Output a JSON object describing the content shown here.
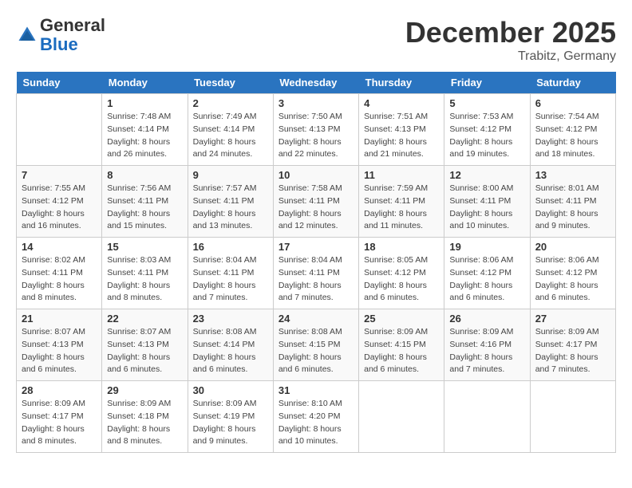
{
  "header": {
    "logo_line1": "General",
    "logo_line2": "Blue",
    "month_title": "December 2025",
    "location": "Trabitz, Germany"
  },
  "weekdays": [
    "Sunday",
    "Monday",
    "Tuesday",
    "Wednesday",
    "Thursday",
    "Friday",
    "Saturday"
  ],
  "weeks": [
    [
      {
        "day": "",
        "info": ""
      },
      {
        "day": "1",
        "info": "Sunrise: 7:48 AM\nSunset: 4:14 PM\nDaylight: 8 hours\nand 26 minutes."
      },
      {
        "day": "2",
        "info": "Sunrise: 7:49 AM\nSunset: 4:14 PM\nDaylight: 8 hours\nand 24 minutes."
      },
      {
        "day": "3",
        "info": "Sunrise: 7:50 AM\nSunset: 4:13 PM\nDaylight: 8 hours\nand 22 minutes."
      },
      {
        "day": "4",
        "info": "Sunrise: 7:51 AM\nSunset: 4:13 PM\nDaylight: 8 hours\nand 21 minutes."
      },
      {
        "day": "5",
        "info": "Sunrise: 7:53 AM\nSunset: 4:12 PM\nDaylight: 8 hours\nand 19 minutes."
      },
      {
        "day": "6",
        "info": "Sunrise: 7:54 AM\nSunset: 4:12 PM\nDaylight: 8 hours\nand 18 minutes."
      }
    ],
    [
      {
        "day": "7",
        "info": "Sunrise: 7:55 AM\nSunset: 4:12 PM\nDaylight: 8 hours\nand 16 minutes."
      },
      {
        "day": "8",
        "info": "Sunrise: 7:56 AM\nSunset: 4:11 PM\nDaylight: 8 hours\nand 15 minutes."
      },
      {
        "day": "9",
        "info": "Sunrise: 7:57 AM\nSunset: 4:11 PM\nDaylight: 8 hours\nand 13 minutes."
      },
      {
        "day": "10",
        "info": "Sunrise: 7:58 AM\nSunset: 4:11 PM\nDaylight: 8 hours\nand 12 minutes."
      },
      {
        "day": "11",
        "info": "Sunrise: 7:59 AM\nSunset: 4:11 PM\nDaylight: 8 hours\nand 11 minutes."
      },
      {
        "day": "12",
        "info": "Sunrise: 8:00 AM\nSunset: 4:11 PM\nDaylight: 8 hours\nand 10 minutes."
      },
      {
        "day": "13",
        "info": "Sunrise: 8:01 AM\nSunset: 4:11 PM\nDaylight: 8 hours\nand 9 minutes."
      }
    ],
    [
      {
        "day": "14",
        "info": "Sunrise: 8:02 AM\nSunset: 4:11 PM\nDaylight: 8 hours\nand 8 minutes."
      },
      {
        "day": "15",
        "info": "Sunrise: 8:03 AM\nSunset: 4:11 PM\nDaylight: 8 hours\nand 8 minutes."
      },
      {
        "day": "16",
        "info": "Sunrise: 8:04 AM\nSunset: 4:11 PM\nDaylight: 8 hours\nand 7 minutes."
      },
      {
        "day": "17",
        "info": "Sunrise: 8:04 AM\nSunset: 4:11 PM\nDaylight: 8 hours\nand 7 minutes."
      },
      {
        "day": "18",
        "info": "Sunrise: 8:05 AM\nSunset: 4:12 PM\nDaylight: 8 hours\nand 6 minutes."
      },
      {
        "day": "19",
        "info": "Sunrise: 8:06 AM\nSunset: 4:12 PM\nDaylight: 8 hours\nand 6 minutes."
      },
      {
        "day": "20",
        "info": "Sunrise: 8:06 AM\nSunset: 4:12 PM\nDaylight: 8 hours\nand 6 minutes."
      }
    ],
    [
      {
        "day": "21",
        "info": "Sunrise: 8:07 AM\nSunset: 4:13 PM\nDaylight: 8 hours\nand 6 minutes."
      },
      {
        "day": "22",
        "info": "Sunrise: 8:07 AM\nSunset: 4:13 PM\nDaylight: 8 hours\nand 6 minutes."
      },
      {
        "day": "23",
        "info": "Sunrise: 8:08 AM\nSunset: 4:14 PM\nDaylight: 8 hours\nand 6 minutes."
      },
      {
        "day": "24",
        "info": "Sunrise: 8:08 AM\nSunset: 4:15 PM\nDaylight: 8 hours\nand 6 minutes."
      },
      {
        "day": "25",
        "info": "Sunrise: 8:09 AM\nSunset: 4:15 PM\nDaylight: 8 hours\nand 6 minutes."
      },
      {
        "day": "26",
        "info": "Sunrise: 8:09 AM\nSunset: 4:16 PM\nDaylight: 8 hours\nand 7 minutes."
      },
      {
        "day": "27",
        "info": "Sunrise: 8:09 AM\nSunset: 4:17 PM\nDaylight: 8 hours\nand 7 minutes."
      }
    ],
    [
      {
        "day": "28",
        "info": "Sunrise: 8:09 AM\nSunset: 4:17 PM\nDaylight: 8 hours\nand 8 minutes."
      },
      {
        "day": "29",
        "info": "Sunrise: 8:09 AM\nSunset: 4:18 PM\nDaylight: 8 hours\nand 8 minutes."
      },
      {
        "day": "30",
        "info": "Sunrise: 8:09 AM\nSunset: 4:19 PM\nDaylight: 8 hours\nand 9 minutes."
      },
      {
        "day": "31",
        "info": "Sunrise: 8:10 AM\nSunset: 4:20 PM\nDaylight: 8 hours\nand 10 minutes."
      },
      {
        "day": "",
        "info": ""
      },
      {
        "day": "",
        "info": ""
      },
      {
        "day": "",
        "info": ""
      }
    ]
  ]
}
